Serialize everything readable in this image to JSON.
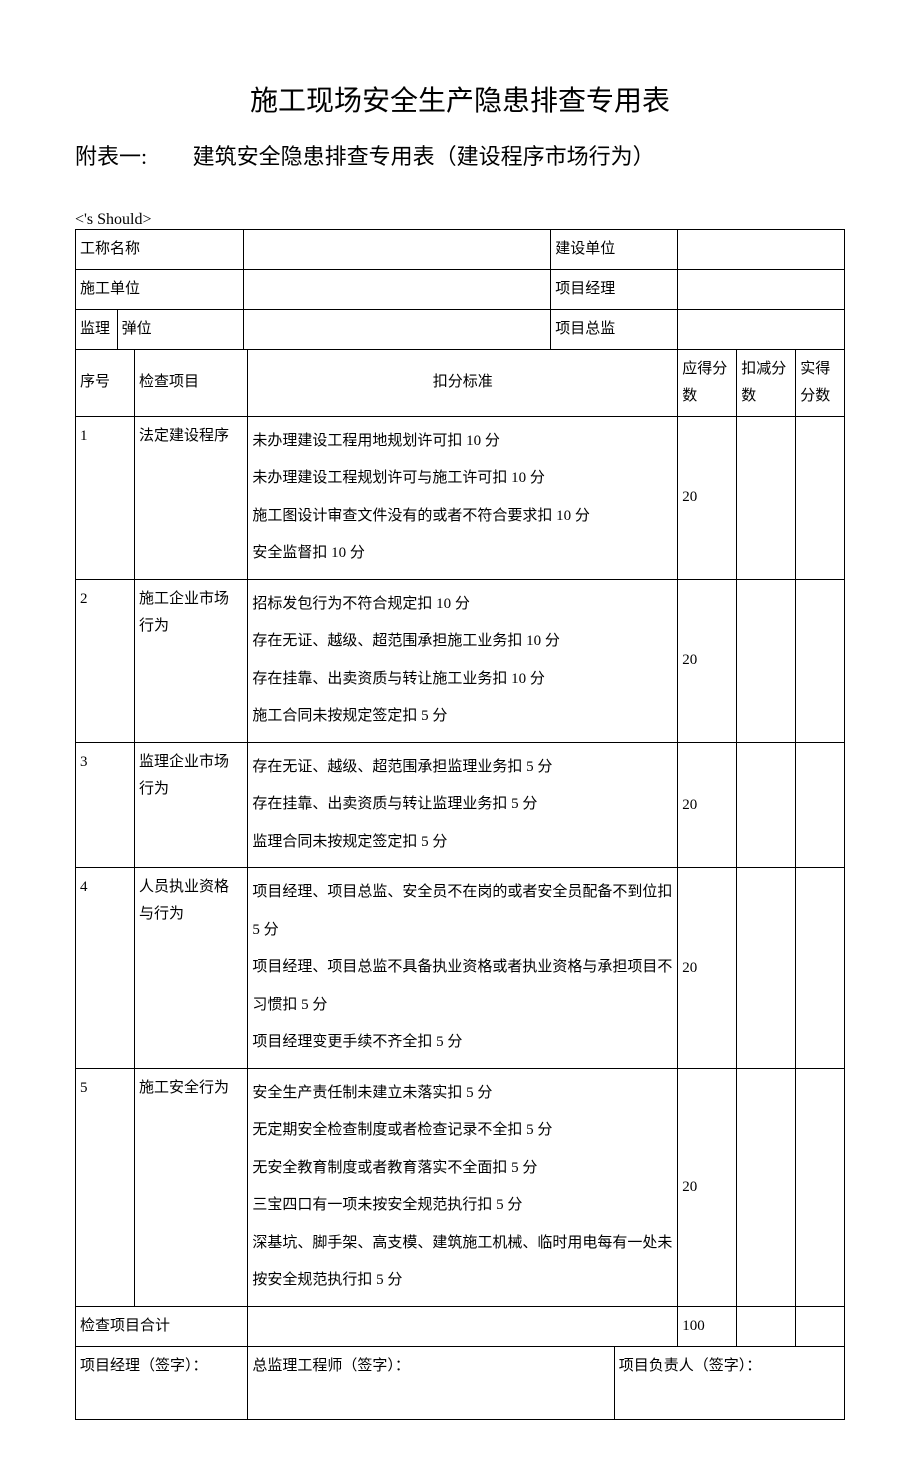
{
  "title": "施工现场安全生产隐患排查专用表",
  "subtitle_prefix": "附表一:",
  "subtitle_main": "建筑安全隐患排查专用表（建设程序市场行为）",
  "header": {
    "project_name_label": "工称名称",
    "build_unit_label": "建设单位",
    "construct_unit_label": "施工单位",
    "project_manager_label": "项目经理",
    "supervise_label1": "监理",
    "supervise_label2": "弹位",
    "chief_supervisor_label": "项目总监"
  },
  "columns": {
    "seq": "序号",
    "item": "检查项目",
    "criteria": "扣分标准",
    "should": "应得分数",
    "deduct": "扣减分数",
    "actual": "实得分数"
  },
  "rows": [
    {
      "seq": "1",
      "item": "法定建设程序",
      "criteria": "未办理建设工程用地规划许可扣 10 分\n未办理建设工程规划许可与施工许可扣 10 分\n施工图设计审查文件没有的或者不符合要求扣 10 分\n安全监督扣 10 分",
      "should": "20"
    },
    {
      "seq": "2",
      "item": "施工企业市场行为",
      "criteria": "招标发包行为不符合规定扣 10 分\n存在无证、越级、超范围承担施工业务扣 10 分\n存在挂靠、出卖资质与转让施工业务扣 10 分\n施工合同未按规定签定扣 5 分",
      "should": "20"
    },
    {
      "seq": "3",
      "item": "监理企业市场行为",
      "criteria": "存在无证、越级、超范围承担监理业务扣 5 分\n存在挂靠、出卖资质与转让监理业务扣 5 分\n监理合同未按规定签定扣 5 分",
      "should": "20"
    },
    {
      "seq": "4",
      "item": "人员执业资格与行为",
      "criteria": "项目经理、项目总监、安全员不在岗的或者安全员配备不到位扣 5 分\n项目经理、项目总监不具备执业资格或者执业资格与承担项目不习惯扣 5 分\n项目经理变更手续不齐全扣 5 分",
      "should": "20"
    },
    {
      "seq": "5",
      "item": "施工安全行为",
      "criteria": "安全生产责任制未建立未落实扣 5 分\n无定期安全检查制度或者检查记录不全扣 5 分\n无安全教育制度或者教育落实不全面扣 5 分\n三宝四口有一项未按安全规范执行扣 5 分\n深基坑、脚手架、高支模、建筑施工机械、临时用电每有一处未按安全规范执行扣 5 分",
      "should": "20"
    }
  ],
  "total_label": "检查项目合计",
  "total_should": "100",
  "signatures": {
    "pm": "项目经理（签字）：",
    "chief": "总监理工程师（签字）：",
    "owner": "项目负责人（签字）："
  }
}
